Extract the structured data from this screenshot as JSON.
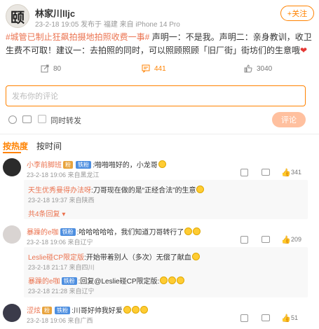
{
  "post": {
    "avatar_char": "颐",
    "author": "林家川lljc",
    "meta": "23-2-18 19:05  发布于 福建  来自 iPhone 14 Pro",
    "follow_label": "+关注",
    "topic": "#城管已制止狂飙拍摄地拍照收费一事#",
    "text_part1": " 声明一：不是我。声明二：亲身教训，收卫生费不可取！建议一：去拍照的同时，可以照顾照顾「旧厂街」街坊们的生意哦",
    "heart": "❤",
    "repost_count": "80",
    "comment_count": "441",
    "like_count": "3040"
  },
  "compose": {
    "placeholder": "发布你的评论",
    "repost_label": "同时转发",
    "submit_label": "评论"
  },
  "tabs": [
    {
      "label": "按热度",
      "active": true
    },
    {
      "label": "按时间",
      "active": false
    }
  ],
  "comments": [
    {
      "name": "小李前脚班",
      "text": ":啪啪啪好的，小龙哥",
      "meta": "23-2-18 19:06  来自黑龙江",
      "likes": "341",
      "replies": [
        {
          "name": "天生优秀曼得办法呀",
          "text": ":刀哥现在做的是“正经合法”的生意",
          "meta": "23-2-18 19:37  来自陕西"
        }
      ],
      "more": "共4条回复"
    },
    {
      "name": "暴躁的e咖",
      "text": ":哈哈哈哈哈，我们知道刀哥转行了",
      "meta": "23-2-18 19:06  来自辽宁",
      "likes": "209",
      "replies": [
        {
          "name": "Leslie碰CP限定版",
          "text": ":开始带着别人（多次）无偿了献血",
          "meta": "23-2-18 21:17  来自四川"
        },
        {
          "name": "暴躁的e咖",
          "text": ":回复@Leslie碰CP限定版:",
          "meta": "23-2-18 21:28  来自辽宁"
        }
      ]
    },
    {
      "name": "涩炫",
      "text": ":川哥好帅我好爱",
      "meta": "23-2-18 19:06  来自广西",
      "likes": "51"
    }
  ]
}
